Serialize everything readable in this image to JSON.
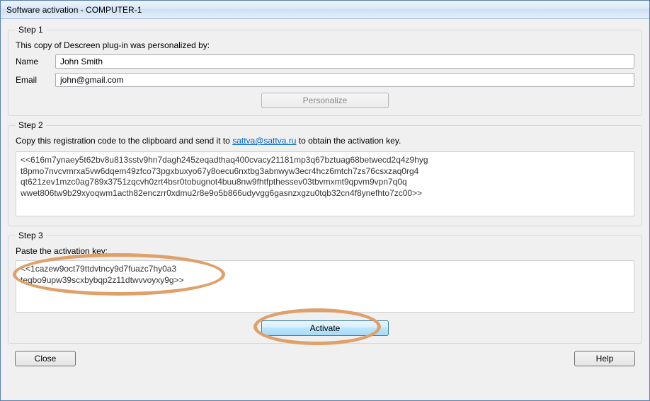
{
  "window": {
    "title": "Software activation - COMPUTER-1"
  },
  "step1": {
    "legend": "Step 1",
    "intro": "This copy of Descreen plug-in was personalized by:",
    "name_label": "Name",
    "name_value": "John Smith",
    "email_label": "Email",
    "email_value": "john@gmail.com",
    "personalize_btn": "Personalize"
  },
  "step2": {
    "legend": "Step 2",
    "instr_before": "Copy this registration code to the clipboard and send it to ",
    "link_text": "sattva@sattva.ru",
    "instr_after": " to obtain the activation key.",
    "regcode": "<<616m7ynaey5t62bv8u813sstv9hn7dagh245zeqadthaq400cvacy21181mp3q67bztuag68betwecd2q4z9hyg\nt8pmo7nvcvmrxa5vw6dqem49zfco73pgxbuxyo67y8oecu6nxtbg3abnwyw3ecr4hcz6mtch7zs76csxzaq0rg4\nqt621zev1mzc0ag789x3751zqcvh0zrt4bsr0tobugnot4buu8nw9fhtfpthessev03tbvmxmt9qpvm9vpn7q0q\nwwet806tw9b29xyoqwm1acth82enczrr0xdmu2r8e9o5b866udyvgg6gasnzxgzu0tqb32cn4f8ynefhto7zc00>>"
  },
  "step3": {
    "legend": "Step 3",
    "instr": "Paste the activation key:",
    "actkey": "<<1cazew9oct79ttdvtncy9d7fuazc7hy0a3\nteqbo9upw39scxbybqp2z11dtwvvoyxy9g>>",
    "activate_btn": "Activate"
  },
  "bottom": {
    "close_btn": "Close",
    "help_btn": "Help"
  }
}
